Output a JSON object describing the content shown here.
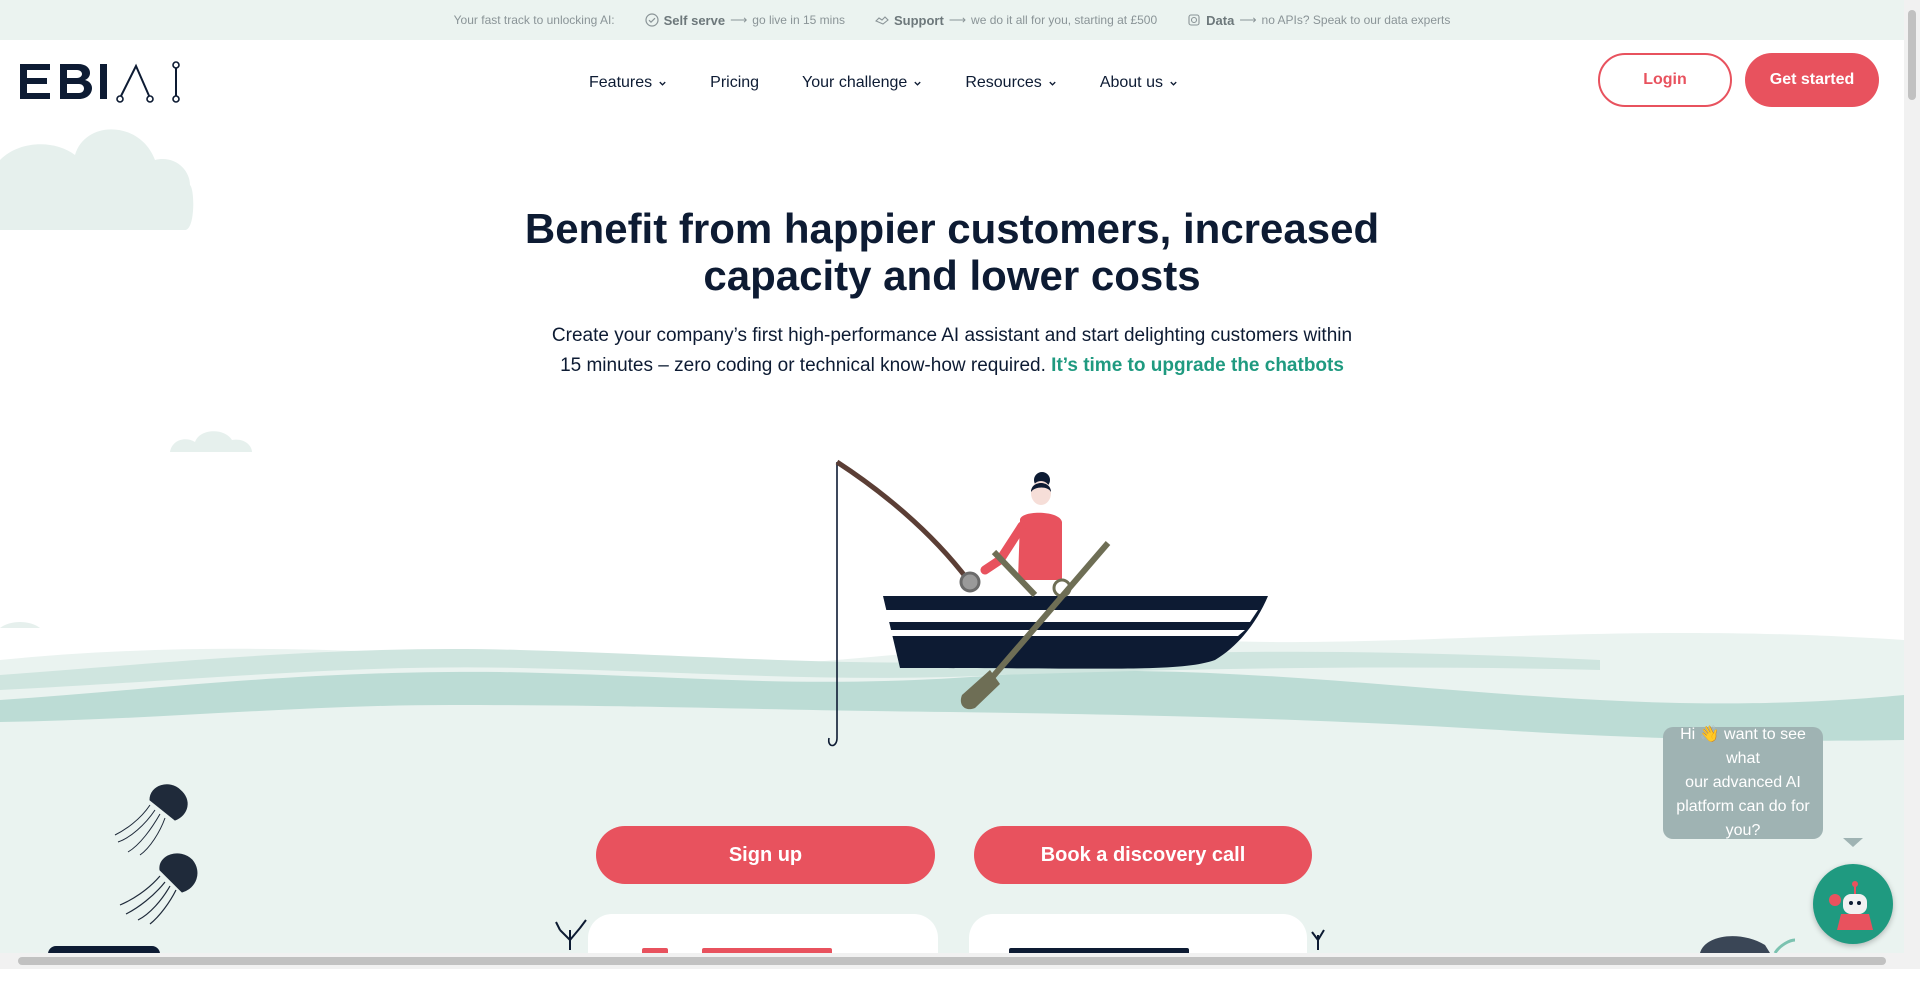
{
  "topbar": {
    "intro": "Your fast track to unlocking AI:",
    "items": [
      {
        "icon": "check-circle-icon",
        "title": "Self serve",
        "arrow": "⟶",
        "text": "go live in 15 mins"
      },
      {
        "icon": "handshake-icon",
        "title": "Support",
        "arrow": "⟶",
        "text": "we do it all for you, starting at £500"
      },
      {
        "icon": "data-icon",
        "title": "Data",
        "arrow": "⟶",
        "text": "no APIs? Speak to our data experts"
      }
    ]
  },
  "header": {
    "logo_text": "EBI AI",
    "nav": [
      {
        "label": "Features",
        "dropdown": true
      },
      {
        "label": "Pricing",
        "dropdown": false
      },
      {
        "label": "Your challenge",
        "dropdown": true
      },
      {
        "label": "Resources",
        "dropdown": true
      },
      {
        "label": "About us",
        "dropdown": true
      }
    ],
    "login_label": "Login",
    "get_started_label": "Get started"
  },
  "hero": {
    "title_line1": "Benefit from happier customers, increased",
    "title_line2": "capacity and lower costs",
    "subtitle_line1": "Create your company’s first high-performance AI assistant and start delighting customers within",
    "subtitle_line2": "15 minutes – zero coding or technical know-how required.",
    "subtitle_link": "It’s time to upgrade the chatbots"
  },
  "cta": {
    "signup_label": "Sign up",
    "discovery_label": "Book a discovery call"
  },
  "chat": {
    "bubble_line1": "Hi 👋 want to see what",
    "bubble_line2": "our advanced AI",
    "bubble_line3": "platform can do for you?"
  },
  "colors": {
    "brand_red": "#e8525e",
    "navy": "#0d1b33",
    "teal": "#1f9a80",
    "sea": "#eaf3f0",
    "wave": "#bcdcd5"
  }
}
